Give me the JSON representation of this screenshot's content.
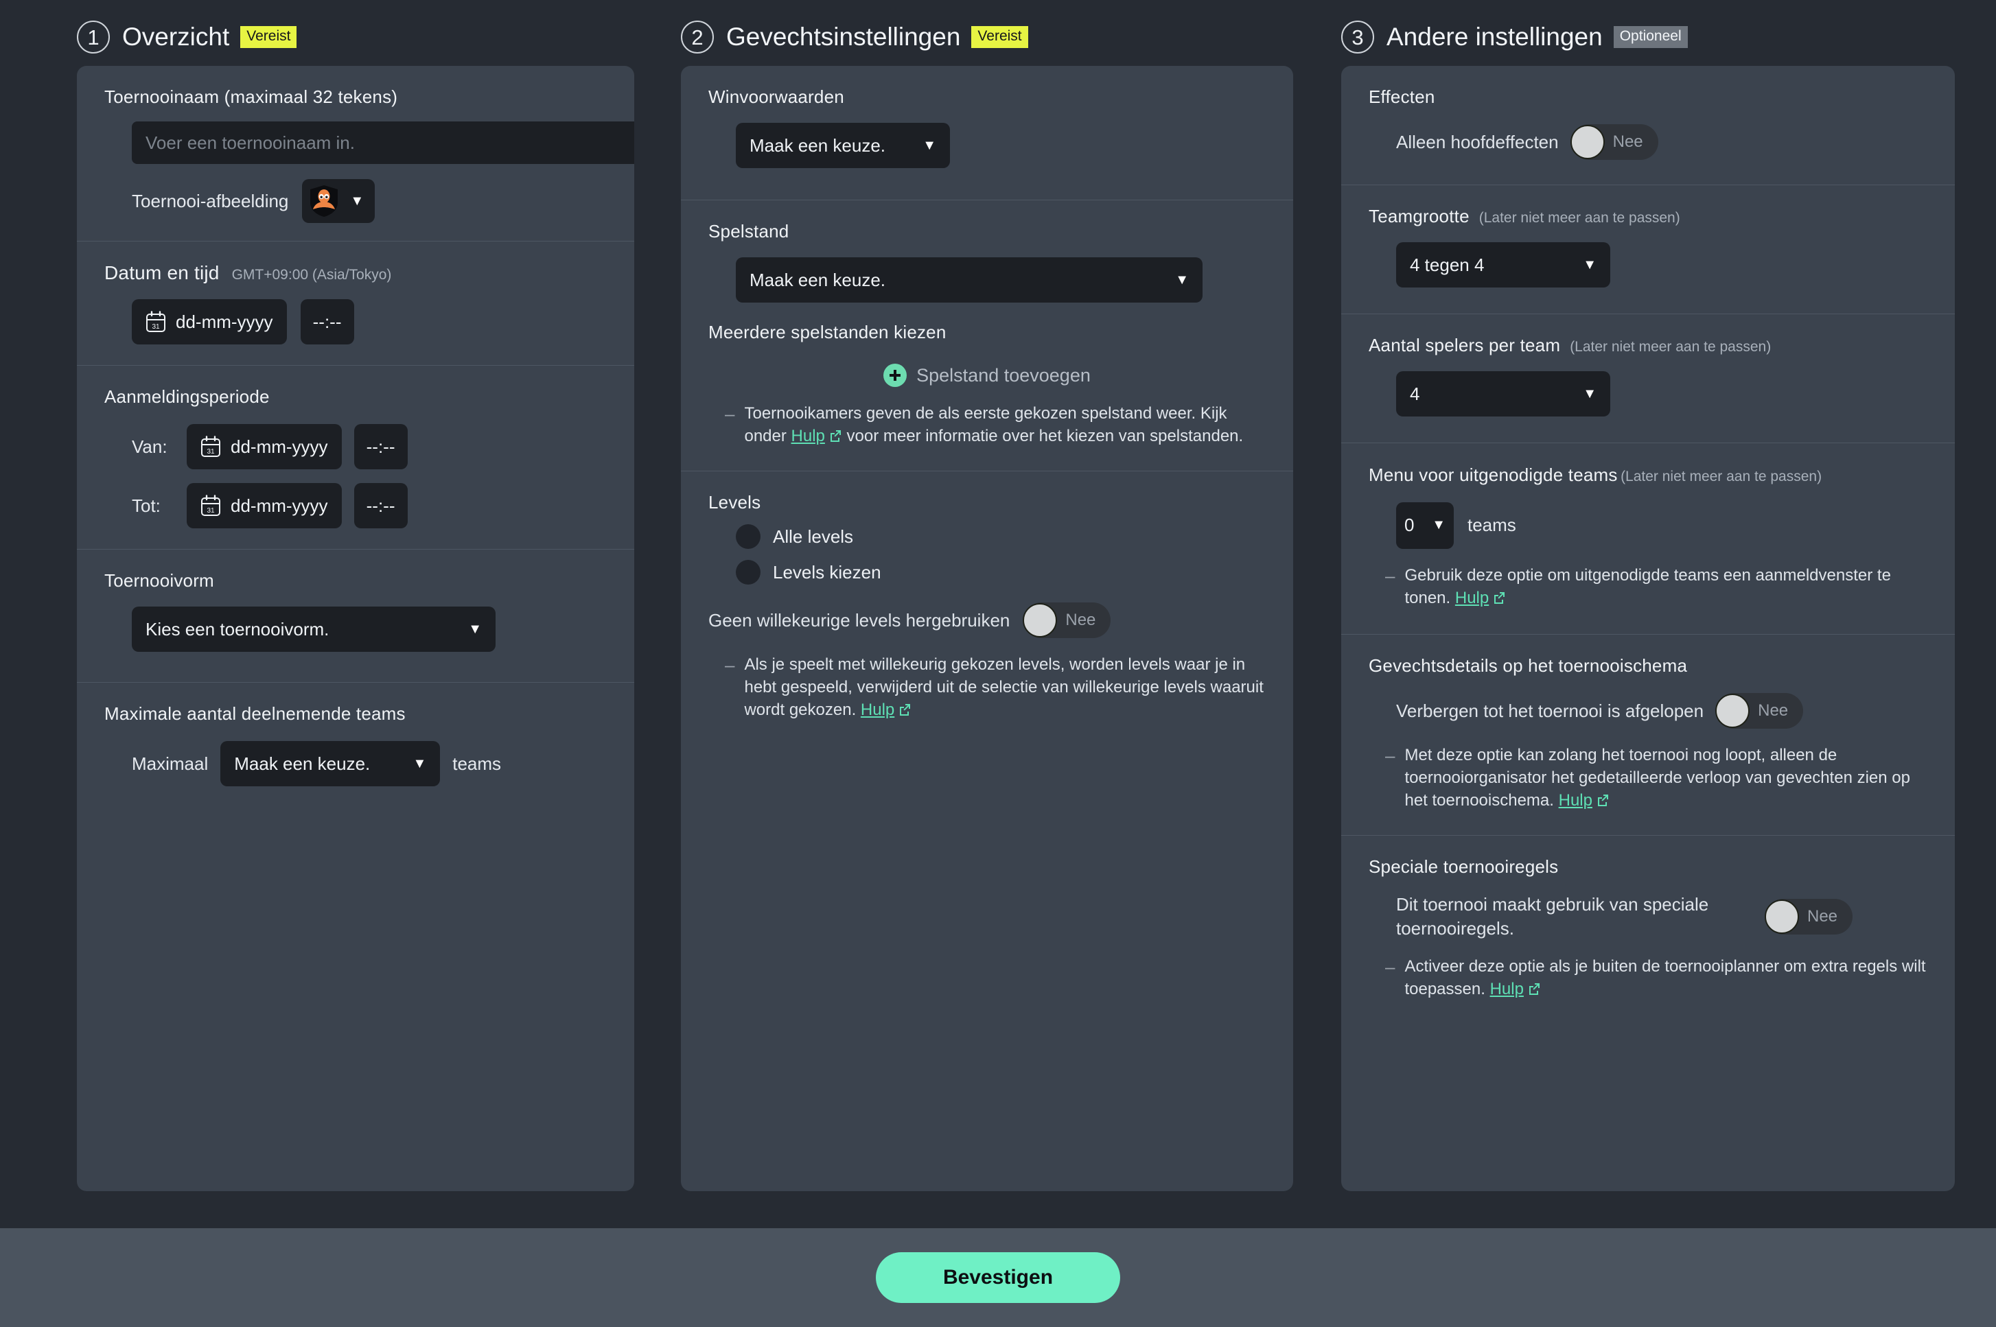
{
  "sections": [
    {
      "number": "1",
      "title": "Overzicht",
      "badge": "Vereist"
    },
    {
      "number": "2",
      "title": "Gevechtsinstellingen",
      "badge": "Vereist"
    },
    {
      "number": "3",
      "title": "Andere instellingen",
      "badge": "Optioneel"
    }
  ],
  "overview": {
    "tournament_name": {
      "label": "Toernooinaam (maximaal 32 tekens)",
      "placeholder": "Voer een toernooinaam in.",
      "value": ""
    },
    "tournament_image": {
      "label": "Toernooi-afbeelding",
      "icon": "squid-shield-icon",
      "caret": "▼"
    },
    "datetime": {
      "label": "Datum en tijd",
      "timezone": "GMT+09:00 (Asia/Tokyo)",
      "date_placeholder": "dd-mm-yyyy",
      "time_placeholder": "--:--"
    },
    "registration_period": {
      "label": "Aanmeldingsperiode",
      "from_label": "Van:",
      "to_label": "Tot:",
      "date_placeholder": "dd-mm-yyyy",
      "time_placeholder": "--:--"
    },
    "tournament_format": {
      "label": "Toernooivorm",
      "value": "Kies een toernooivorm.",
      "caret": "▼"
    },
    "max_teams": {
      "label": "Maximale aantal deelnemende teams",
      "prefix": "Maximaal",
      "value": "Maak een keuze.",
      "suffix": "teams",
      "caret": "▼"
    }
  },
  "battle_settings": {
    "win_conditions": {
      "label": "Winvoorwaarden",
      "value": "Maak een keuze.",
      "caret": "▼"
    },
    "game_mode": {
      "label": "Spelstand",
      "value": "Maak een keuze.",
      "caret": "▼",
      "multi_label": "Meerdere spelstanden kiezen",
      "add_label": "Spelstand toevoegen",
      "note_before": "Toernooikamers geven de als eerste gekozen spelstand weer. Kijk onder ",
      "note_link": "Hulp",
      "note_after": " voor meer informatie over het kiezen van spelstanden."
    },
    "levels": {
      "label": "Levels",
      "option_all": "Alle levels",
      "option_choose": "Levels kiezen",
      "no_reuse_label": "Geen willekeurige levels hergebruiken",
      "no_reuse_value": "Nee",
      "note": "Als je speelt met willekeurig gekozen levels, worden levels waar je in hebt gespeeld, verwijderd uit de selectie van willekeurige levels waaruit wordt gekozen. ",
      "note_link": "Hulp"
    }
  },
  "other_settings": {
    "effects": {
      "label": "Effecten",
      "main_only_label": "Alleen hoofdeffecten",
      "main_only_value": "Nee"
    },
    "team_size": {
      "label": "Teamgrootte",
      "note": "(Later niet meer aan te passen)",
      "value": "4 tegen 4",
      "caret": "▼"
    },
    "players_per_team": {
      "label": "Aantal spelers per team",
      "note": "(Later niet meer aan te passen)",
      "value": "4",
      "caret": "▼"
    },
    "invited_teams_menu": {
      "label": "Menu voor uitgenodigde teams",
      "note": "(Later niet meer aan te passen)",
      "value": "0",
      "caret": "▼",
      "suffix": "teams",
      "hint": "Gebruik deze optie om uitgenodigde teams een aanmeldvenster te tonen. ",
      "hint_link": "Hulp"
    },
    "battle_details": {
      "label": "Gevechtsdetails op het toernooischema",
      "hide_label": "Verbergen tot het toernooi is afgelopen",
      "hide_value": "Nee",
      "hint": "Met deze optie kan zolang het toernooi nog loopt, alleen de toernooiorganisator het gedetailleerde verloop van gevechten zien op het toernooischema. ",
      "hint_link": "Hulp"
    },
    "special_rules": {
      "label": "Speciale toernooiregels",
      "toggle_label": "Dit toernooi maakt gebruik van speciale toernooiregels.",
      "toggle_value": "Nee",
      "hint": "Activeer deze optie als je buiten de toernooiplanner om extra regels wilt toepassen. ",
      "hint_link": "Hulp"
    }
  },
  "footer": {
    "confirm_label": "Bevestigen"
  },
  "colors": {
    "page_bg": "#262b33",
    "card_bg": "#3b434e",
    "field_bg": "#1c1f24",
    "accent_green": "#6ff0c5",
    "link_green": "#5ee0b4",
    "badge_required_bg": "#e7f443",
    "badge_optional_bg": "#6d747d",
    "footer_bg": "#4b545f"
  }
}
